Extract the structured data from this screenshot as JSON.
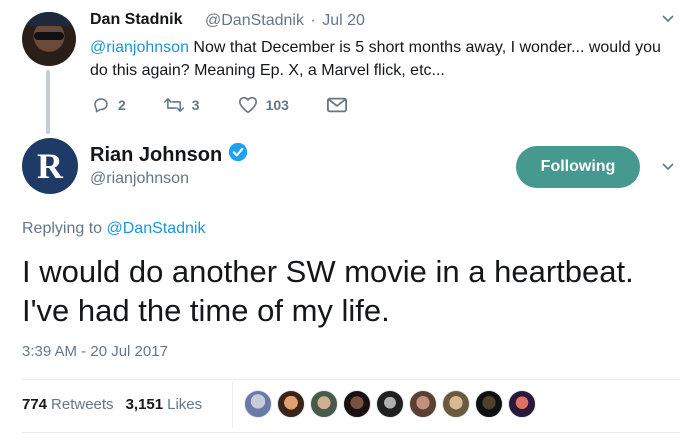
{
  "parent_tweet": {
    "author_name": "Dan Stadnik",
    "author_handle": "@DanStadnik",
    "separator": "·",
    "date": "Jul 20",
    "mention": "@rianjohnson",
    "text": " Now that December is 5 short months away, I wonder... would you do this again? Meaning Ep. X, a Marvel flick, etc...",
    "replies": "2",
    "retweets": "3",
    "likes": "103",
    "icons": [
      "reply-icon",
      "retweet-icon",
      "heart-icon",
      "envelope-icon",
      "chevron-down-icon"
    ]
  },
  "main_tweet": {
    "author_name": "Rian Johnson",
    "author_handle": "@rianjohnson",
    "avatar_letter": "R",
    "follow_button": "Following",
    "replying_prefix": "Replying to ",
    "replying_to": "@DanStadnik",
    "text_line1": "I would do another SW movie in a heartbeat.",
    "text_line2": "I've had the time of my life.",
    "timestamp": "3:39 AM - 20 Jul 2017",
    "retweet_count": "774",
    "retweet_label": "Retweets",
    "like_count": "3,151",
    "like_label": "Likes",
    "liker_avatar_count": 9
  },
  "colors": {
    "link": "#1b95e0",
    "secondary_text": "#657786",
    "follow_button_bg": "#45998f",
    "verified_badge": "#1da1f2",
    "rian_avatar_bg": "#1e3a66"
  }
}
